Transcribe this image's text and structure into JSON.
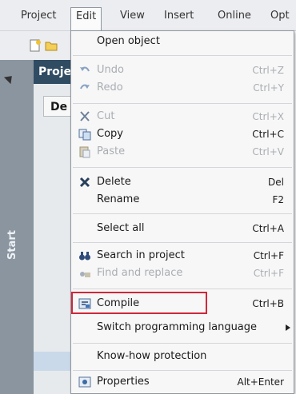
{
  "menubar": {
    "items": [
      {
        "label": "Project"
      },
      {
        "label": "Edit"
      },
      {
        "label": "View"
      },
      {
        "label": "Insert"
      },
      {
        "label": "Online"
      },
      {
        "label": "Opt"
      }
    ]
  },
  "sidebar": {
    "start_label": "Start"
  },
  "project_panel": {
    "header": "Proje",
    "tab": "De"
  },
  "edit_menu": {
    "items": [
      {
        "label": "Open object",
        "shortcut": ""
      },
      {
        "label": "Undo",
        "shortcut": "Ctrl+Z"
      },
      {
        "label": "Redo",
        "shortcut": "Ctrl+Y"
      },
      {
        "label": "Cut",
        "shortcut": "Ctrl+X"
      },
      {
        "label": "Copy",
        "shortcut": "Ctrl+C"
      },
      {
        "label": "Paste",
        "shortcut": "Ctrl+V"
      },
      {
        "label": "Delete",
        "shortcut": "Del"
      },
      {
        "label": "Rename",
        "shortcut": "F2"
      },
      {
        "label": "Select all",
        "shortcut": "Ctrl+A"
      },
      {
        "label": "Search in project",
        "shortcut": "Ctrl+F"
      },
      {
        "label": "Find and replace",
        "shortcut": "Ctrl+F"
      },
      {
        "label": "Compile",
        "shortcut": "Ctrl+B"
      },
      {
        "label": "Switch programming language",
        "shortcut": ""
      },
      {
        "label": "Know-how protection",
        "shortcut": ""
      },
      {
        "label": "Properties",
        "shortcut": "Alt+Enter"
      }
    ]
  },
  "colors": {
    "highlight_border": "#d0273a",
    "project_header": "#2f4c63",
    "start_strip": "#8a95a0"
  }
}
